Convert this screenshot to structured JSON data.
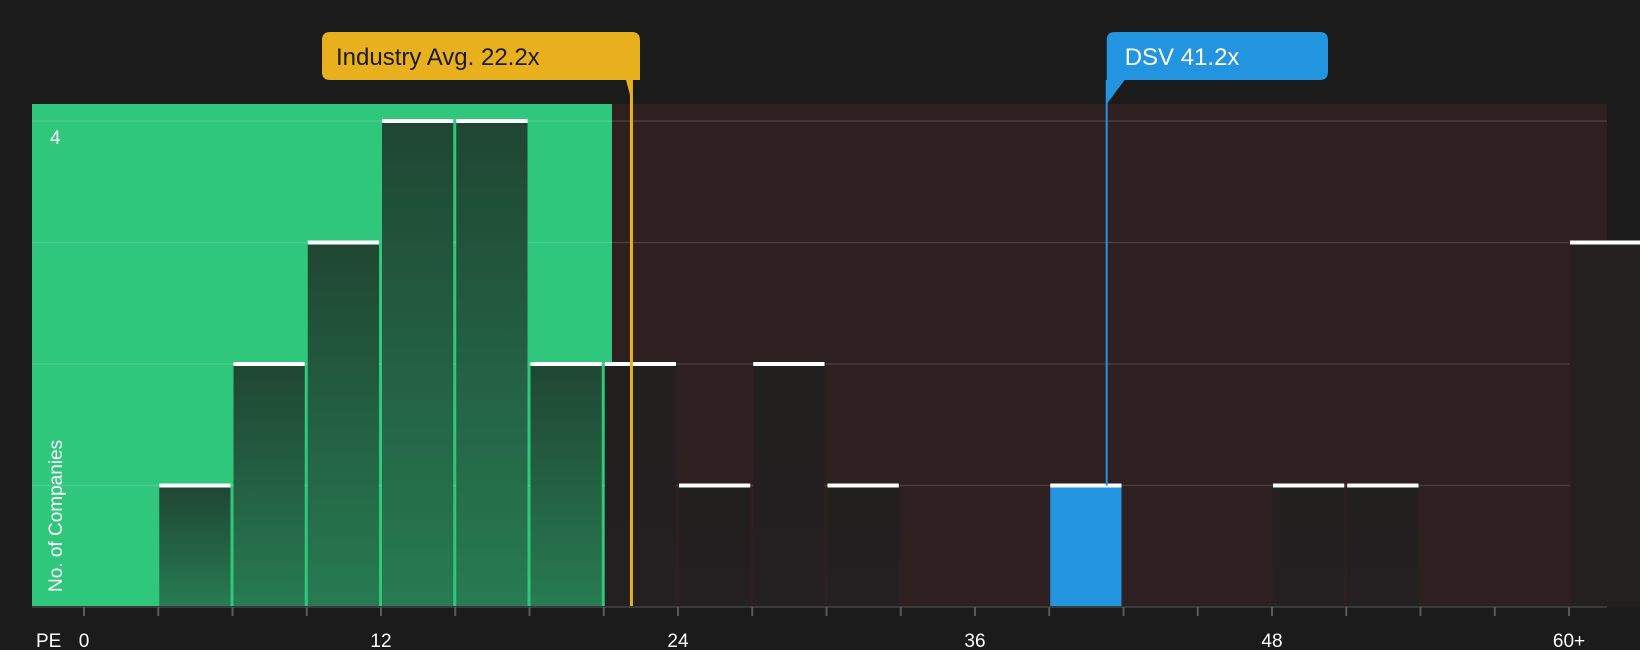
{
  "chart_data": {
    "type": "bar",
    "x_axis_label": "PE",
    "y_axis_label": "No. of Companies",
    "x_ticks": [
      "0",
      "12",
      "24",
      "36",
      "48",
      "60+"
    ],
    "y_max_label": "4",
    "ylim": [
      0,
      4
    ],
    "bin_width": 3,
    "industry_avg": {
      "label": "Industry Avg. 22.2x",
      "value": 22.2,
      "color": "#e8b01c"
    },
    "company": {
      "label": "DSV 41.2x",
      "value": 41.2,
      "color": "#2394e0"
    },
    "fair_zone_color": "#2ec77c",
    "above_zone_color": "#2e1f20",
    "bins": [
      {
        "start": 3,
        "count": 1
      },
      {
        "start": 6,
        "count": 2
      },
      {
        "start": 9,
        "count": 3
      },
      {
        "start": 12,
        "count": 4
      },
      {
        "start": 15,
        "count": 4
      },
      {
        "start": 18,
        "count": 2
      },
      {
        "start": 21,
        "count": 2
      },
      {
        "start": 24,
        "count": 1
      },
      {
        "start": 27,
        "count": 2
      },
      {
        "start": 30,
        "count": 1
      },
      {
        "start": 39,
        "count": 1,
        "highlight": true
      },
      {
        "start": 48,
        "count": 1
      },
      {
        "start": 51,
        "count": 1
      },
      {
        "start": 60,
        "count": 3
      }
    ]
  }
}
